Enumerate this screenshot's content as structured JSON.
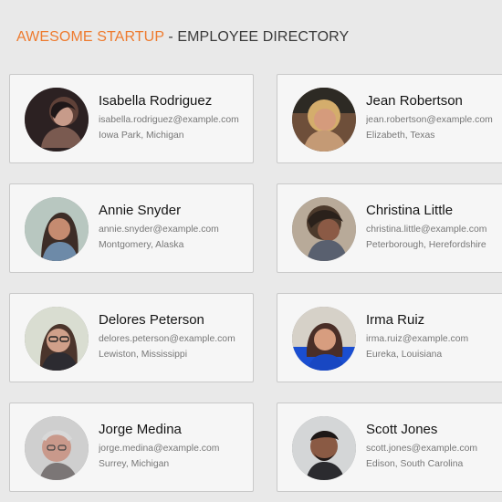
{
  "header": {
    "brand": "AWESOME STARTUP",
    "separator": " - ",
    "title": "EMPLOYEE DIRECTORY"
  },
  "employees": [
    {
      "name": "Isabella Rodriguez",
      "email": "isabella.rodriguez@example.com",
      "location": "Iowa Park, Michigan"
    },
    {
      "name": "Jean Robertson",
      "email": "jean.robertson@example.com",
      "location": "Elizabeth, Texas"
    },
    {
      "name": "Annie Snyder",
      "email": "annie.snyder@example.com",
      "location": "Montgomery, Alaska"
    },
    {
      "name": "Christina Little",
      "email": "christina.little@example.com",
      "location": "Peterborough, Herefordshire"
    },
    {
      "name": "Delores Peterson",
      "email": "delores.peterson@example.com",
      "location": "Lewiston, Mississippi"
    },
    {
      "name": "Irma Ruiz",
      "email": "irma.ruiz@example.com",
      "location": "Eureka, Louisiana"
    },
    {
      "name": "Jorge Medina",
      "email": "jorge.medina@example.com",
      "location": "Surrey, Michigan"
    },
    {
      "name": "Scott Jones",
      "email": "scott.jones@example.com",
      "location": "Edison, South Carolina"
    }
  ],
  "colors": {
    "brand": "#ee7b2f",
    "heading": "#3b3b3b",
    "background": "#e9e9e9",
    "card": "#f6f6f6",
    "card_border": "#c9c9c9"
  }
}
